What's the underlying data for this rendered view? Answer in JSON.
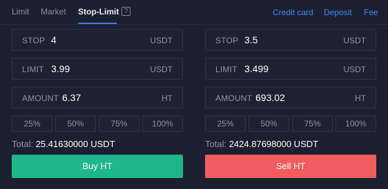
{
  "tabs": {
    "limit": "Limit",
    "market": "Market",
    "stop_limit": "Stop-Limit",
    "help": "?"
  },
  "links": {
    "credit_card": "Credit card",
    "deposit": "Deposit",
    "fee": "Fee"
  },
  "buy": {
    "stop": {
      "label": "STOP",
      "value": "4",
      "unit": "USDT"
    },
    "limit": {
      "label": "LIMIT",
      "value": "3.99",
      "unit": "USDT"
    },
    "amount": {
      "label": "AMOUNT",
      "value": "6.37",
      "unit": "HT"
    },
    "percents": [
      "25%",
      "50%",
      "75%",
      "100%"
    ],
    "total_label": "Total:",
    "total_value": "25.41630000 USDT",
    "button": "Buy HT"
  },
  "sell": {
    "stop": {
      "label": "STOP",
      "value": "3.5",
      "unit": "USDT"
    },
    "limit": {
      "label": "LIMIT",
      "value": "3.499",
      "unit": "USDT"
    },
    "amount": {
      "label": "AMOUNT",
      "value": "693.02",
      "unit": "HT"
    },
    "percents": [
      "25%",
      "50%",
      "75%",
      "100%"
    ],
    "total_label": "Total:",
    "total_value": "2424.87698000 USDT",
    "button": "Sell HT"
  },
  "colors": {
    "buy": "#1cb88a",
    "sell": "#f25c5c",
    "accent": "#3d8bf5",
    "background": "#1b2030"
  }
}
